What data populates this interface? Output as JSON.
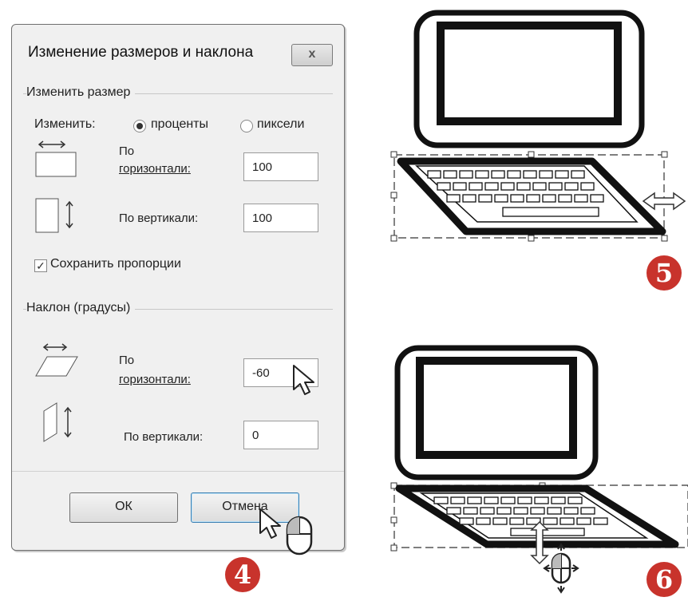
{
  "dialog": {
    "title": "Изменение размеров и наклона",
    "close_label": "x",
    "resize": {
      "group_label": "Изменить размер",
      "change_label": "Изменить:",
      "percent_option": "проценты",
      "pixels_option": "пиксели",
      "selected_unit": "проценты",
      "horizontal_label_line1": "По",
      "horizontal_label_line2": "горизонтали:",
      "horizontal_value": "100",
      "vertical_label": "По вертикали:",
      "vertical_value": "100",
      "keep_ratio_label": "Сохранить пропорции",
      "keep_ratio_checked": true
    },
    "skew": {
      "group_label": "Наклон (градусы)",
      "horizontal_label_line1": "По",
      "horizontal_label_line2": "горизонтали:",
      "horizontal_value": "-60",
      "vertical_label": "По вертикали:",
      "vertical_value": "0"
    },
    "ok_label": "ОК",
    "cancel_label": "Отмена"
  },
  "step_badges": {
    "step4": "4",
    "step5": "5",
    "step6": "6"
  },
  "colors": {
    "badge": "#c8332c",
    "dialog_bg": "#f0f0f0"
  }
}
